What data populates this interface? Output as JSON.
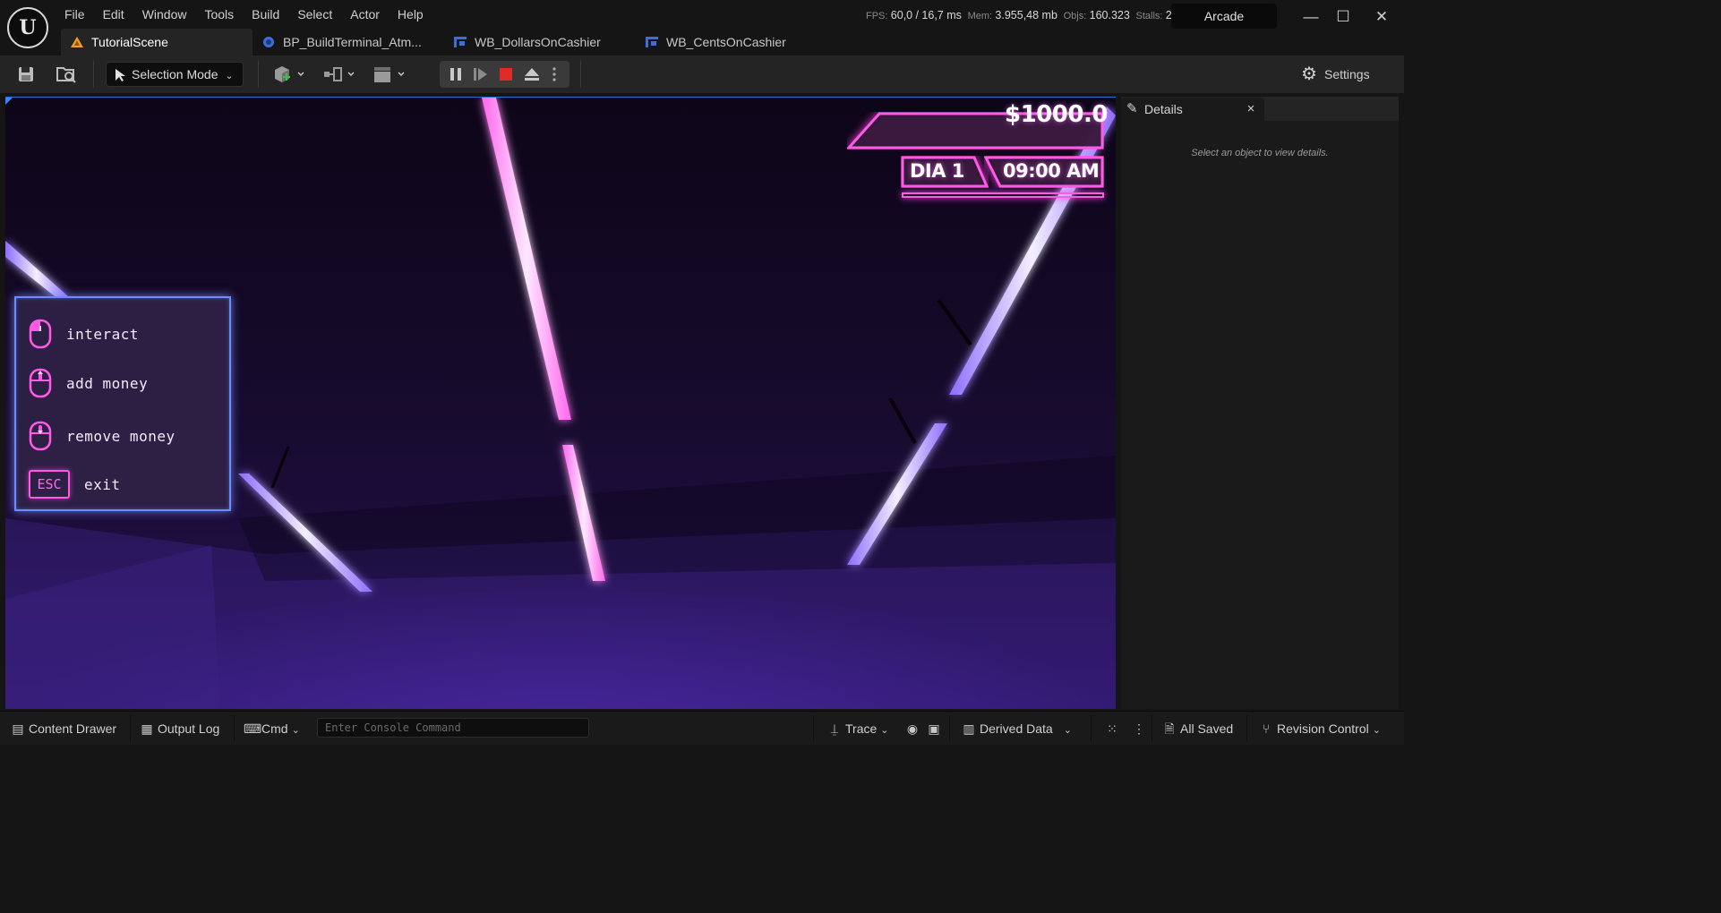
{
  "menubar": {
    "items": [
      "File",
      "Edit",
      "Window",
      "Tools",
      "Build",
      "Select",
      "Actor",
      "Help"
    ]
  },
  "stats": {
    "fps_label": "FPS:",
    "fps_value": "60,0",
    "frame_time": "/ 16,7 ms",
    "mem_label": "Mem:",
    "mem_value": "3.955,48 mb",
    "objs_label": "Objs:",
    "objs_value": "160.323",
    "stalls_label": "Stalls:",
    "stalls_value": "2"
  },
  "window": {
    "layout_label": "Arcade",
    "minimize": "—",
    "maximize": "☐",
    "close": "✕"
  },
  "tabs": [
    {
      "label": "TutorialScene",
      "icon": "level-icon"
    },
    {
      "label": "BP_BuildTerminal_Atm...",
      "icon": "blueprint-icon"
    },
    {
      "label": "WB_DollarsOnCashier",
      "icon": "widget-blueprint-icon"
    },
    {
      "label": "WB_CentsOnCashier",
      "icon": "widget-blueprint-icon"
    }
  ],
  "toolbar": {
    "selection_mode": "Selection Mode",
    "settings": "Settings"
  },
  "hud": {
    "money": "$1000.0",
    "day": "DIA 1",
    "time": "09:00 AM"
  },
  "controls": {
    "items": [
      {
        "label": "interact",
        "icon": "mouse-left-click-icon"
      },
      {
        "label": "add money",
        "icon": "mouse-scroll-up-icon"
      },
      {
        "label": "remove money",
        "icon": "mouse-scroll-down-icon"
      },
      {
        "label": "exit",
        "key": "ESC"
      }
    ]
  },
  "details": {
    "title": "Details",
    "close": "×",
    "empty_message": "Select an object to view details."
  },
  "statusbar": {
    "content_drawer": "Content Drawer",
    "output_log": "Output Log",
    "cmd": "Cmd",
    "console_placeholder": "Enter Console Command",
    "trace": "Trace",
    "derived_data": "Derived Data",
    "all_saved": "All Saved",
    "revision_control": "Revision Control"
  },
  "colors": {
    "neon_pink": "#ff5ae6",
    "neon_blue": "#6b8cff",
    "accent_blue": "#2b6fd6",
    "stop_red": "#e02a2a"
  }
}
